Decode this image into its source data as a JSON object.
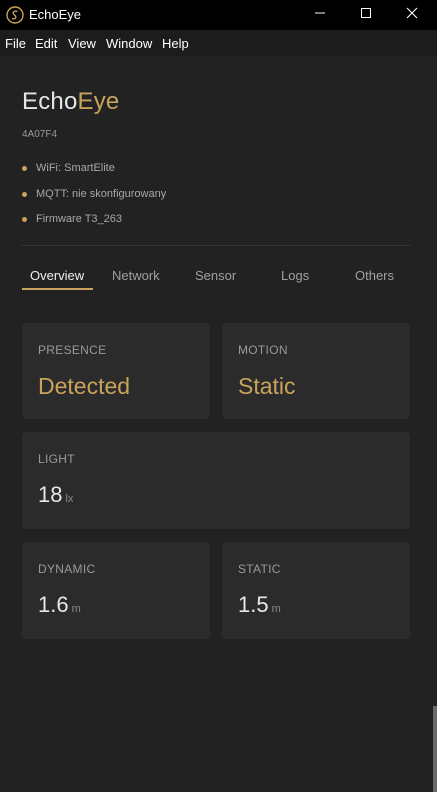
{
  "window": {
    "title": "EchoEye"
  },
  "icons": {
    "app": "echo-logo-icon",
    "minimize": "minimize-icon",
    "maximize": "maximize-icon",
    "close": "close-icon",
    "status": "status-dot-icon"
  },
  "menu": [
    "File",
    "Edit",
    "View",
    "Window",
    "Help"
  ],
  "header": {
    "title_part1": "Echo",
    "title_part2": "Eye",
    "device_id": "4A07F4",
    "status": [
      "WiFi: SmartElite",
      "MQTT: nie skonfigurowany",
      "Firmware T3_263"
    ]
  },
  "tabs": [
    "Overview",
    "Network",
    "Sensor",
    "Logs",
    "Others"
  ],
  "active_tab": "Overview",
  "cards": {
    "presence": {
      "label": "PRESENCE",
      "value": "Detected"
    },
    "motion": {
      "label": "MOTION",
      "value": "Static"
    },
    "light": {
      "label": "LIGHT",
      "value": "18",
      "unit": "lx"
    },
    "dynamic": {
      "label": "DYNAMIC",
      "value": "1.6",
      "unit": "m"
    },
    "static": {
      "label": "STATIC",
      "value": "1.5",
      "unit": "m"
    }
  },
  "colors": {
    "accent": "#c9a35c",
    "background": "#222222",
    "card": "#2b2b2b"
  }
}
